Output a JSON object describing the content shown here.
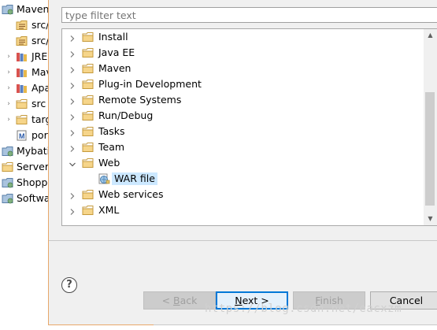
{
  "background_explorer": {
    "items": [
      {
        "label": "Maven",
        "icon": "project-icon",
        "twisty": "expanded",
        "indent": 0
      },
      {
        "label": "src/",
        "icon": "source-folder-icon",
        "twisty": "",
        "indent": 1
      },
      {
        "label": "src/",
        "icon": "source-folder-icon",
        "twisty": "",
        "indent": 1
      },
      {
        "label": "JRE",
        "icon": "library-icon",
        "twisty": "collapsed",
        "indent": 1
      },
      {
        "label": "Mav",
        "icon": "library-icon",
        "twisty": "collapsed",
        "indent": 1
      },
      {
        "label": "Apa",
        "icon": "library-icon",
        "twisty": "collapsed",
        "indent": 1
      },
      {
        "label": "src",
        "icon": "folder-icon",
        "twisty": "collapsed",
        "indent": 1
      },
      {
        "label": "targ",
        "icon": "folder-icon",
        "twisty": "collapsed",
        "indent": 1
      },
      {
        "label": "por",
        "icon": "maven-pom-icon",
        "twisty": "",
        "indent": 1
      },
      {
        "label": "Mybati",
        "icon": "project-icon",
        "twisty": "",
        "indent": 0
      },
      {
        "label": "Servers",
        "icon": "folder-icon",
        "twisty": "",
        "indent": 0
      },
      {
        "label": "Shopp",
        "icon": "project-icon",
        "twisty": "",
        "indent": 0
      },
      {
        "label": "Softwa",
        "icon": "project-icon",
        "twisty": "",
        "indent": 0
      }
    ]
  },
  "dialog": {
    "filter": {
      "value": "",
      "placeholder": "type filter text"
    },
    "tree": [
      {
        "label": "Install",
        "expanded": false,
        "selected": false,
        "indent": 0,
        "icon": "folder-icon"
      },
      {
        "label": "Java EE",
        "expanded": false,
        "selected": false,
        "indent": 0,
        "icon": "folder-icon"
      },
      {
        "label": "Maven",
        "expanded": false,
        "selected": false,
        "indent": 0,
        "icon": "folder-icon"
      },
      {
        "label": "Plug-in Development",
        "expanded": false,
        "selected": false,
        "indent": 0,
        "icon": "folder-icon"
      },
      {
        "label": "Remote Systems",
        "expanded": false,
        "selected": false,
        "indent": 0,
        "icon": "folder-icon"
      },
      {
        "label": "Run/Debug",
        "expanded": false,
        "selected": false,
        "indent": 0,
        "icon": "folder-icon"
      },
      {
        "label": "Tasks",
        "expanded": false,
        "selected": false,
        "indent": 0,
        "icon": "folder-icon"
      },
      {
        "label": "Team",
        "expanded": false,
        "selected": false,
        "indent": 0,
        "icon": "folder-icon"
      },
      {
        "label": "Web",
        "expanded": true,
        "selected": false,
        "indent": 0,
        "icon": "folder-icon"
      },
      {
        "label": "WAR file",
        "expanded": null,
        "selected": true,
        "indent": 1,
        "icon": "war-file-icon"
      },
      {
        "label": "Web services",
        "expanded": false,
        "selected": false,
        "indent": 0,
        "icon": "folder-icon"
      },
      {
        "label": "XML",
        "expanded": false,
        "selected": false,
        "indent": 0,
        "icon": "folder-icon"
      }
    ],
    "buttons": {
      "back": {
        "pre": "< ",
        "mnemonic": "B",
        "post": "ack",
        "enabled": false
      },
      "next": {
        "pre": "",
        "mnemonic": "N",
        "post": "ext >",
        "enabled": true
      },
      "finish": {
        "pre": "",
        "mnemonic": "F",
        "post": "inish",
        "enabled": false
      },
      "cancel": {
        "label": "Cancel",
        "enabled": true
      }
    },
    "help_label": "?"
  },
  "watermark": "https://blog.csdn.net/eacxzm",
  "colors": {
    "selection": "#cce8ff",
    "folder_fill": "#f6d58a",
    "folder_stroke": "#c59a3c",
    "default_button_border": "#0078d7",
    "dialog_border": "#e8a86a"
  }
}
